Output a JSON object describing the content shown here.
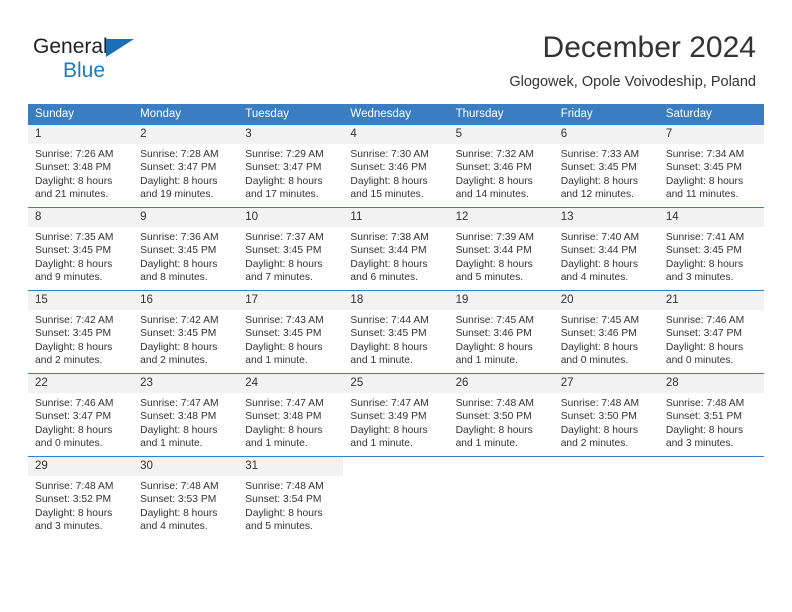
{
  "brand": {
    "name_part1": "General",
    "name_part2": "Blue",
    "triangle_icon": "triangle-logo-icon"
  },
  "header": {
    "title": "December 2024",
    "subtitle": "Glogowek, Opole Voivodeship, Poland"
  },
  "weekday_headers": [
    "Sunday",
    "Monday",
    "Tuesday",
    "Wednesday",
    "Thursday",
    "Friday",
    "Saturday"
  ],
  "colors": {
    "header_blue": "#3a7dc0",
    "daynum_band": "#f2f2f2",
    "brand_blue": "#1c7ac0",
    "text": "#333333"
  },
  "weeks": [
    [
      {
        "day": "1",
        "sunrise": "Sunrise: 7:26 AM",
        "sunset": "Sunset: 3:48 PM",
        "daylight_line1": "Daylight: 8 hours",
        "daylight_line2": "and 21 minutes."
      },
      {
        "day": "2",
        "sunrise": "Sunrise: 7:28 AM",
        "sunset": "Sunset: 3:47 PM",
        "daylight_line1": "Daylight: 8 hours",
        "daylight_line2": "and 19 minutes."
      },
      {
        "day": "3",
        "sunrise": "Sunrise: 7:29 AM",
        "sunset": "Sunset: 3:47 PM",
        "daylight_line1": "Daylight: 8 hours",
        "daylight_line2": "and 17 minutes."
      },
      {
        "day": "4",
        "sunrise": "Sunrise: 7:30 AM",
        "sunset": "Sunset: 3:46 PM",
        "daylight_line1": "Daylight: 8 hours",
        "daylight_line2": "and 15 minutes."
      },
      {
        "day": "5",
        "sunrise": "Sunrise: 7:32 AM",
        "sunset": "Sunset: 3:46 PM",
        "daylight_line1": "Daylight: 8 hours",
        "daylight_line2": "and 14 minutes."
      },
      {
        "day": "6",
        "sunrise": "Sunrise: 7:33 AM",
        "sunset": "Sunset: 3:45 PM",
        "daylight_line1": "Daylight: 8 hours",
        "daylight_line2": "and 12 minutes."
      },
      {
        "day": "7",
        "sunrise": "Sunrise: 7:34 AM",
        "sunset": "Sunset: 3:45 PM",
        "daylight_line1": "Daylight: 8 hours",
        "daylight_line2": "and 11 minutes."
      }
    ],
    [
      {
        "day": "8",
        "sunrise": "Sunrise: 7:35 AM",
        "sunset": "Sunset: 3:45 PM",
        "daylight_line1": "Daylight: 8 hours",
        "daylight_line2": "and 9 minutes."
      },
      {
        "day": "9",
        "sunrise": "Sunrise: 7:36 AM",
        "sunset": "Sunset: 3:45 PM",
        "daylight_line1": "Daylight: 8 hours",
        "daylight_line2": "and 8 minutes."
      },
      {
        "day": "10",
        "sunrise": "Sunrise: 7:37 AM",
        "sunset": "Sunset: 3:45 PM",
        "daylight_line1": "Daylight: 8 hours",
        "daylight_line2": "and 7 minutes."
      },
      {
        "day": "11",
        "sunrise": "Sunrise: 7:38 AM",
        "sunset": "Sunset: 3:44 PM",
        "daylight_line1": "Daylight: 8 hours",
        "daylight_line2": "and 6 minutes."
      },
      {
        "day": "12",
        "sunrise": "Sunrise: 7:39 AM",
        "sunset": "Sunset: 3:44 PM",
        "daylight_line1": "Daylight: 8 hours",
        "daylight_line2": "and 5 minutes."
      },
      {
        "day": "13",
        "sunrise": "Sunrise: 7:40 AM",
        "sunset": "Sunset: 3:44 PM",
        "daylight_line1": "Daylight: 8 hours",
        "daylight_line2": "and 4 minutes."
      },
      {
        "day": "14",
        "sunrise": "Sunrise: 7:41 AM",
        "sunset": "Sunset: 3:45 PM",
        "daylight_line1": "Daylight: 8 hours",
        "daylight_line2": "and 3 minutes."
      }
    ],
    [
      {
        "day": "15",
        "sunrise": "Sunrise: 7:42 AM",
        "sunset": "Sunset: 3:45 PM",
        "daylight_line1": "Daylight: 8 hours",
        "daylight_line2": "and 2 minutes."
      },
      {
        "day": "16",
        "sunrise": "Sunrise: 7:42 AM",
        "sunset": "Sunset: 3:45 PM",
        "daylight_line1": "Daylight: 8 hours",
        "daylight_line2": "and 2 minutes."
      },
      {
        "day": "17",
        "sunrise": "Sunrise: 7:43 AM",
        "sunset": "Sunset: 3:45 PM",
        "daylight_line1": "Daylight: 8 hours",
        "daylight_line2": "and 1 minute."
      },
      {
        "day": "18",
        "sunrise": "Sunrise: 7:44 AM",
        "sunset": "Sunset: 3:45 PM",
        "daylight_line1": "Daylight: 8 hours",
        "daylight_line2": "and 1 minute."
      },
      {
        "day": "19",
        "sunrise": "Sunrise: 7:45 AM",
        "sunset": "Sunset: 3:46 PM",
        "daylight_line1": "Daylight: 8 hours",
        "daylight_line2": "and 1 minute."
      },
      {
        "day": "20",
        "sunrise": "Sunrise: 7:45 AM",
        "sunset": "Sunset: 3:46 PM",
        "daylight_line1": "Daylight: 8 hours",
        "daylight_line2": "and 0 minutes."
      },
      {
        "day": "21",
        "sunrise": "Sunrise: 7:46 AM",
        "sunset": "Sunset: 3:47 PM",
        "daylight_line1": "Daylight: 8 hours",
        "daylight_line2": "and 0 minutes."
      }
    ],
    [
      {
        "day": "22",
        "sunrise": "Sunrise: 7:46 AM",
        "sunset": "Sunset: 3:47 PM",
        "daylight_line1": "Daylight: 8 hours",
        "daylight_line2": "and 0 minutes."
      },
      {
        "day": "23",
        "sunrise": "Sunrise: 7:47 AM",
        "sunset": "Sunset: 3:48 PM",
        "daylight_line1": "Daylight: 8 hours",
        "daylight_line2": "and 1 minute."
      },
      {
        "day": "24",
        "sunrise": "Sunrise: 7:47 AM",
        "sunset": "Sunset: 3:48 PM",
        "daylight_line1": "Daylight: 8 hours",
        "daylight_line2": "and 1 minute."
      },
      {
        "day": "25",
        "sunrise": "Sunrise: 7:47 AM",
        "sunset": "Sunset: 3:49 PM",
        "daylight_line1": "Daylight: 8 hours",
        "daylight_line2": "and 1 minute."
      },
      {
        "day": "26",
        "sunrise": "Sunrise: 7:48 AM",
        "sunset": "Sunset: 3:50 PM",
        "daylight_line1": "Daylight: 8 hours",
        "daylight_line2": "and 1 minute."
      },
      {
        "day": "27",
        "sunrise": "Sunrise: 7:48 AM",
        "sunset": "Sunset: 3:50 PM",
        "daylight_line1": "Daylight: 8 hours",
        "daylight_line2": "and 2 minutes."
      },
      {
        "day": "28",
        "sunrise": "Sunrise: 7:48 AM",
        "sunset": "Sunset: 3:51 PM",
        "daylight_line1": "Daylight: 8 hours",
        "daylight_line2": "and 3 minutes."
      }
    ],
    [
      {
        "day": "29",
        "sunrise": "Sunrise: 7:48 AM",
        "sunset": "Sunset: 3:52 PM",
        "daylight_line1": "Daylight: 8 hours",
        "daylight_line2": "and 3 minutes."
      },
      {
        "day": "30",
        "sunrise": "Sunrise: 7:48 AM",
        "sunset": "Sunset: 3:53 PM",
        "daylight_line1": "Daylight: 8 hours",
        "daylight_line2": "and 4 minutes."
      },
      {
        "day": "31",
        "sunrise": "Sunrise: 7:48 AM",
        "sunset": "Sunset: 3:54 PM",
        "daylight_line1": "Daylight: 8 hours",
        "daylight_line2": "and 5 minutes."
      },
      {
        "day": "",
        "sunrise": "",
        "sunset": "",
        "daylight_line1": "",
        "daylight_line2": ""
      },
      {
        "day": "",
        "sunrise": "",
        "sunset": "",
        "daylight_line1": "",
        "daylight_line2": ""
      },
      {
        "day": "",
        "sunrise": "",
        "sunset": "",
        "daylight_line1": "",
        "daylight_line2": ""
      },
      {
        "day": "",
        "sunrise": "",
        "sunset": "",
        "daylight_line1": "",
        "daylight_line2": ""
      }
    ]
  ]
}
